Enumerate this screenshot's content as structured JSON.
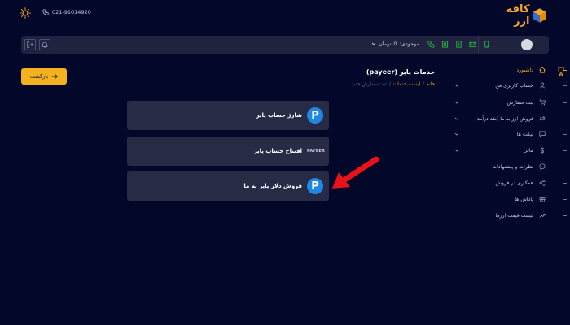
{
  "header": {
    "logo_text": "کافه ارز",
    "phone": "021-91014920"
  },
  "toolbar": {
    "balance_label": "موجودی:",
    "balance_value": "0",
    "balance_unit": "تومان"
  },
  "back_button": {
    "label": "بازگشت"
  },
  "page": {
    "title": "خدمات پایر (payeer)",
    "breadcrumb": [
      {
        "label": "خانه"
      },
      {
        "label": "لیست خدمات"
      },
      {
        "label": "ثبت سفارش جدید"
      }
    ]
  },
  "services": [
    {
      "label": "شارژ حساب پایر",
      "logo": "P"
    },
    {
      "label": "افتتاح حساب پایر",
      "logo": "PAYEER"
    },
    {
      "label": "فروش دلار پایر به ما",
      "logo": "P"
    }
  ],
  "sidebar": {
    "items": [
      {
        "label": "داشبورد",
        "icon": "home-icon",
        "active": true,
        "has_submenu": false
      },
      {
        "label": "حساب کاربری من",
        "icon": "user-icon",
        "active": false,
        "has_submenu": true
      },
      {
        "label": "ثبت سفارش",
        "icon": "cart-icon",
        "active": false,
        "has_submenu": true
      },
      {
        "label": "فروش ارز به ما (نقد درآمد)",
        "icon": "exchange-icon",
        "active": false,
        "has_submenu": true
      },
      {
        "label": "تیکت ها",
        "icon": "chat-icon",
        "active": false,
        "has_submenu": true
      },
      {
        "label": "مالی",
        "icon": "dollar-icon",
        "active": false,
        "has_submenu": true
      },
      {
        "label": "نظرات و پیشنهادات",
        "icon": "comment-icon",
        "active": false,
        "has_submenu": false
      },
      {
        "label": "همکاری در فروش",
        "icon": "share-icon",
        "active": false,
        "has_submenu": false
      },
      {
        "label": "پاداش ها",
        "icon": "gift-icon",
        "active": false,
        "has_submenu": false
      },
      {
        "label": "لیست قیمت ارزها",
        "icon": "trend-icon",
        "active": false,
        "has_submenu": false
      }
    ]
  },
  "colors": {
    "background": "#03082a",
    "accent": "#f5a623",
    "card": "#272b46",
    "payeer_blue": "#1e88e5",
    "annotation_red": "#e8121a",
    "icon_green": "#27c93f"
  }
}
